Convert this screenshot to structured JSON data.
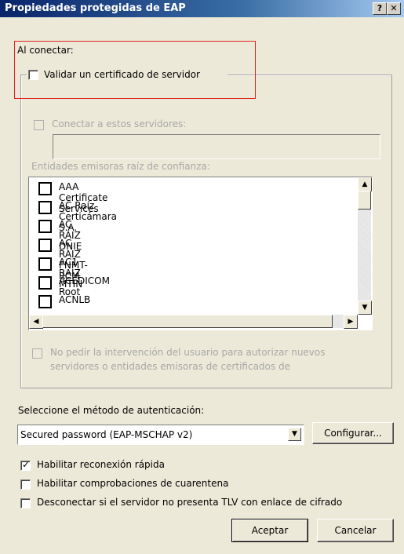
{
  "window": {
    "title": "Propiedades protegidas de EAP",
    "help_btn": "?",
    "close_btn": "✕"
  },
  "on_connect_label": "Al conectar:",
  "validate_cert": {
    "label": "Validar un certificado de servidor",
    "checked": false
  },
  "connect_servers": {
    "label": "Conectar a estos servidores:",
    "value": ""
  },
  "trusted_roots": {
    "label": "Entidades emisoras raíz de confianza:",
    "items": [
      "AAA Certificate Services",
      "AC Raíz Certicámara S.A.",
      "AC RAIZ DNIE",
      "AC RAIZ FNMT-RCM",
      "AC1 RAIZ MTIN",
      "ACEDICOM Root",
      "ACNLB"
    ]
  },
  "no_prompt": {
    "line1": "No pedir la intervención del usuario para autorizar nuevos",
    "line2": "servidores o entidades emisoras de certificados de"
  },
  "auth_method": {
    "label": "Seleccione el método de autenticación:",
    "selected": "Secured password (EAP-MSCHAP v2)",
    "configure_btn": "Configurar..."
  },
  "options": [
    {
      "label": "Habilitar reconexión rápida",
      "checked": true
    },
    {
      "label": "Habilitar comprobaciones de cuarentena",
      "checked": false
    },
    {
      "label": "Desconectar si el servidor no presenta TLV con enlace de cifrado",
      "checked": false
    }
  ],
  "buttons": {
    "ok": "Aceptar",
    "cancel": "Cancelar"
  }
}
